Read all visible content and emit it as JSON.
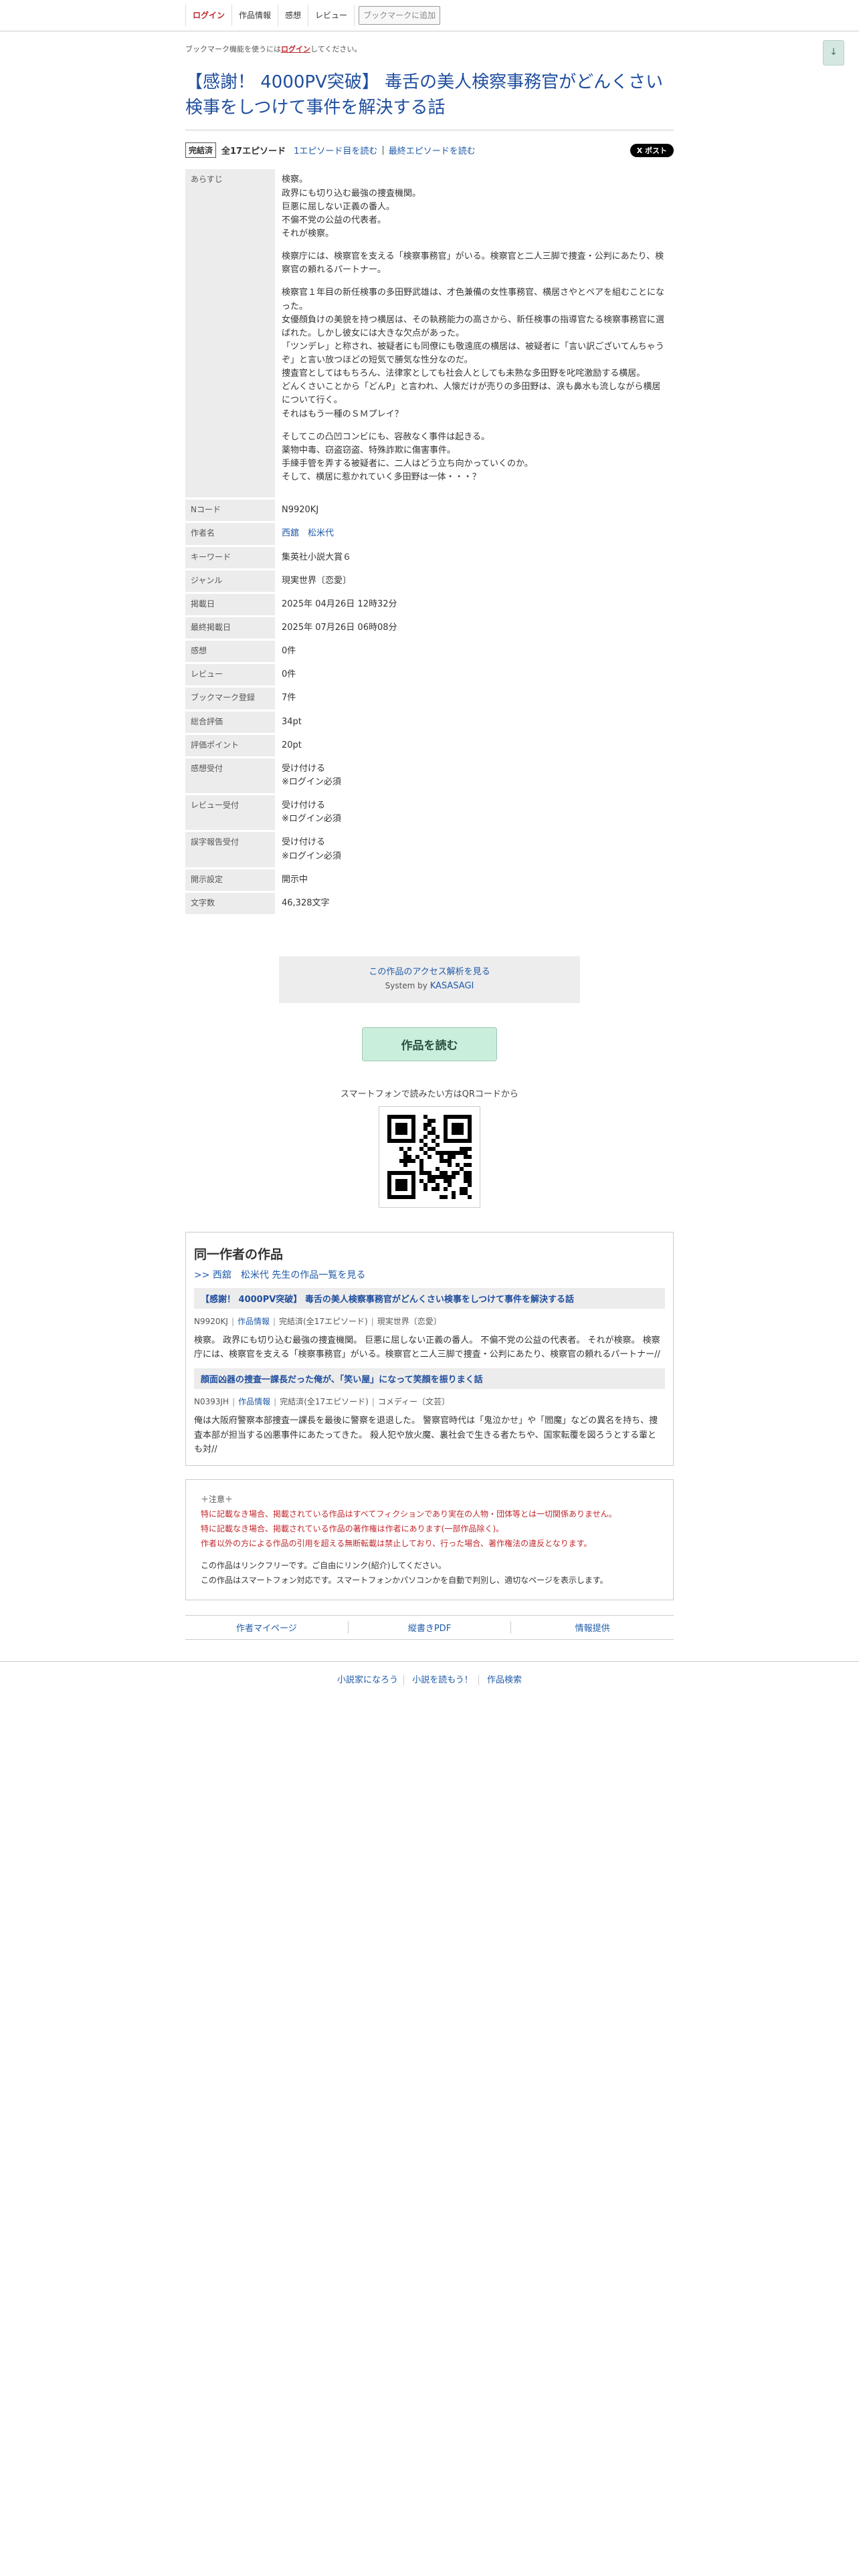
{
  "nav": {
    "login": "ログイン",
    "info": "作品情報",
    "impression": "感想",
    "review": "レビュー",
    "bookmark_add": "ブックマークに追加",
    "scroll_down": "↓"
  },
  "bookmark_note": {
    "before": "ブックマーク機能を使うには",
    "link": "ログイン",
    "after": "してください。"
  },
  "novel": {
    "title": "【感謝！ 4000PV突破】 毒舌の美人検察事務官がどんくさい検事をしつけて事件を解決する話",
    "status_badge": "完結済",
    "episodes": "全17エピソード",
    "first_ep": "1エピソード目を読む",
    "sep": "|",
    "last_ep": "最終エピソードを読む",
    "x_post": "X ポスト",
    "synopsis": [
      "検察。\n政界にも切り込む最強の捜査機関。\n巨悪に屈しない正義の番人。\n不偏不党の公益の代表者。\nそれが検察。",
      "検察庁には、検察官を支える「検察事務官」がいる。検察官と二人三脚で捜査・公判にあたり、検察官の頼れるパートナー。",
      "検察官１年目の新任検事の多田野武雄は、才色兼備の女性事務官、横居さやとペアを組むことになった。\n女優顔負けの美貌を持つ横居は、その執務能力の高さから、新任検事の指導官たる検察事務官に選ばれた。しかし彼女には大きな欠点があった。\n「ツンデレ」と称され、被疑者にも同僚にも敬遠底の横居は、被疑者に「言い訳ございてんちゃうぞ」と言い放つほどの短気で勝気な性分なのだ。\n捜査官としてはもちろん、法律家としても社会人としても未熟な多田野を叱咤激励する横居。\nどんくさいことから「どんP」と言われ、人懐だけが売りの多田野は、涙も鼻水も流しながら横居について行く。\nそれはもう一種のＳＭプレイ？",
      "そしてこの凸凹コンビにも、容赦なく事件は起きる。\n薬物中毒、窃盗窃盗、特殊詐欺に傷害事件。\n手練手管を弄する被疑者に、二人はどう立ち向かっていくのか。\nそして、横居に惹かれていく多田野は一体・・・？"
    ]
  },
  "info_rows": [
    {
      "label": "あらすじ",
      "key": "synopsis"
    },
    {
      "label": "Nコード",
      "value": "N9920KJ"
    },
    {
      "label": "作者名",
      "value": "西舘　松米代",
      "link": true
    },
    {
      "label": "キーワード",
      "value": "集英社小説大賞６"
    },
    {
      "label": "ジャンル",
      "value": "現実世界〔恋愛〕"
    },
    {
      "label": "掲載日",
      "value": "2025年 04月26日 12時32分"
    },
    {
      "label": "最終掲載日",
      "value": "2025年 07月26日 06時08分"
    },
    {
      "label": "感想",
      "value": "0件"
    },
    {
      "label": "レビュー",
      "value": "0件"
    },
    {
      "label": "ブックマーク登録",
      "value": "7件"
    },
    {
      "label": "総合評価",
      "value": "34pt"
    },
    {
      "label": "評価ポイント",
      "value": "20pt"
    },
    {
      "label": "感想受付",
      "value": "受け付ける\n※ログイン必須"
    },
    {
      "label": "レビュー受付",
      "value": "受け付ける\n※ログイン必須"
    },
    {
      "label": "誤字報告受付",
      "value": "受け付ける\n※ログイン必須"
    },
    {
      "label": "開示設定",
      "value": "開示中"
    },
    {
      "label": "文字数",
      "value": "46,328文字"
    }
  ],
  "kasasagi": {
    "link": "この作品のアクセス解析を見る",
    "system_prefix": "System by ",
    "system_name": "KASASAGI"
  },
  "read_button": "作品を読む",
  "qr_caption": "スマートフォンで読みたい方はQRコードから",
  "same_author": {
    "heading": "同一作者の作品",
    "more": ">> 西舘　松米代 先生の作品一覧を見る",
    "works": [
      {
        "title": "【感謝！ 4000PV突破】 毒舌の美人検察事務官がどんくさい検事をしつけて事件を解決する話",
        "ncode": "N9920KJ",
        "info": "作品情報",
        "status": "完結済(全17エピソード)",
        "genre": "現実世界〔恋愛〕",
        "desc": "検察。 政界にも切り込む最強の捜査機関。 巨悪に屈しない正義の番人。 不偏不党の公益の代表者。 それが検察。 検察庁には、検察官を支える「検察事務官」がいる。検察官と二人三脚で捜査・公判にあたり、検察官の頼れるパートナー//"
      },
      {
        "title": "顔面凶器の捜査一課長だった俺が、「笑い屋」になって笑顔を振りまく話",
        "ncode": "N0393JH",
        "info": "作品情報",
        "status": "完結済(全17エピソード)",
        "genre": "コメディー〔文芸〕",
        "desc": "俺は大阪府警察本部捜査一課長を最後に警察を退退した。 警察官時代は「鬼泣かせ」や「閻魔」などの異名を持ち、捜査本部が担当する凶悪事件にあたってきた。 殺人犯や放火魔、裏社会で生きる者たちや、国家転覆を図ろうとする輩とも対//"
      }
    ]
  },
  "notice": {
    "head": "＋注意＋",
    "red1": "特に記載なき場合、掲載されている作品はすべてフィクションであり実在の人物・団体等とは一切関係ありません。",
    "red2": "特に記載なき場合、掲載されている作品の著作権は作者にあります(一部作品除く)。",
    "red3": "作者以外の方による作品の引用を超える無断転載は禁止しており、行った場合、著作権法の違反となります。",
    "plain1": "この作品はリンクフリーです。ご自由にリンク(紹介)してください。",
    "plain2": "この作品はスマートフォン対応です。スマートフォンかパソコンかを自動で判別し、適切なページを表示します。"
  },
  "footer_links": [
    "作者マイページ",
    "縦書きPDF",
    "情報提供"
  ],
  "global_footer": [
    "小説家になろう",
    "小説を読もう！",
    "作品検索"
  ]
}
